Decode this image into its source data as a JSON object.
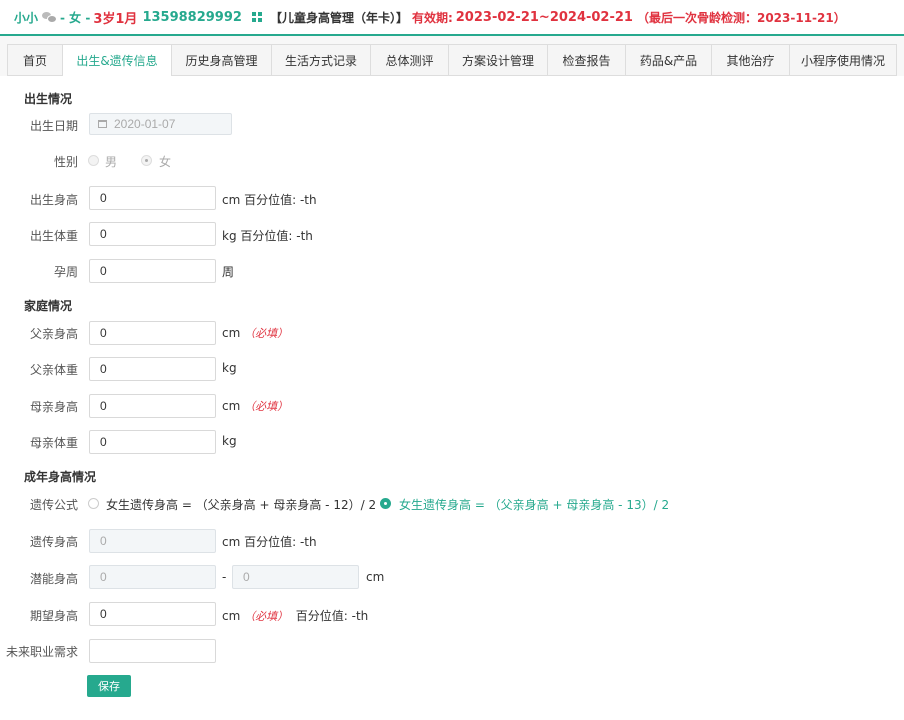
{
  "header": {
    "name": "小小",
    "gender": "- 女 -",
    "age": "3岁1月",
    "phone": "13598829992",
    "plan": "【儿童身高管理（年卡）】",
    "validity_label": "有效期:",
    "validity_range": "2023-02-21~2024-02-21",
    "last_check": "（最后一次骨龄检测：2023-11-21）",
    "colors": {
      "accent": "#26a98e",
      "alert": "#e0323f"
    }
  },
  "tabs": [
    {
      "label": "首页"
    },
    {
      "label": "出生&遗传信息",
      "active": true
    },
    {
      "label": "历史身高管理"
    },
    {
      "label": "生活方式记录"
    },
    {
      "label": "总体测评"
    },
    {
      "label": "方案设计管理"
    },
    {
      "label": "检查报告"
    },
    {
      "label": "药品&产品"
    },
    {
      "label": "其他治疗"
    },
    {
      "label": "小程序使用情况"
    }
  ],
  "birth": {
    "section_title": "出生情况",
    "birth_date_label": "出生日期",
    "birth_date_value": "2020-01-07",
    "gender_label": "性别",
    "gender_male": "男",
    "gender_female": "女",
    "birth_height_label": "出生身高",
    "birth_height_value": "0",
    "birth_height_unit": "cm 百分位值: -th",
    "birth_weight_label": "出生体重",
    "birth_weight_value": "0",
    "birth_weight_unit": "kg 百分位值: -th",
    "gestation_label": "孕周",
    "gestation_value": "0",
    "gestation_unit": "周"
  },
  "family": {
    "section_title": "家庭情况",
    "father_height_label": "父亲身高",
    "father_height_value": "0",
    "father_height_unit": "cm",
    "father_weight_label": "父亲体重",
    "father_weight_value": "0",
    "father_weight_unit": "kg",
    "mother_height_label": "母亲身高",
    "mother_height_value": "0",
    "mother_height_unit": "cm",
    "mother_weight_label": "母亲体重",
    "mother_weight_value": "0",
    "mother_weight_unit": "kg",
    "required_text": "（必填）"
  },
  "adult": {
    "section_title": "成年身高情况",
    "formula_label": "遗传公式",
    "formula_option1": "女生遗传身高 = （父亲身高 + 母亲身高 - 12）/ 2",
    "formula_option2": "女生遗传身高 = （父亲身高 + 母亲身高 - 13）/ 2",
    "genetic_height_label": "遗传身高",
    "genetic_height_value": "0",
    "genetic_height_unit": "cm 百分位值: -th",
    "potential_height_label": "潜能身高",
    "potential_min": "0",
    "potential_sep": "-",
    "potential_max": "0",
    "potential_unit": "cm",
    "expected_height_label": "期望身高",
    "expected_height_value": "0",
    "expected_height_unit": "cm",
    "expected_required": "（必填）",
    "expected_percentile": "百分位值: -th",
    "career_label": "未来职业需求",
    "career_value": ""
  },
  "actions": {
    "save_label": "保存"
  }
}
